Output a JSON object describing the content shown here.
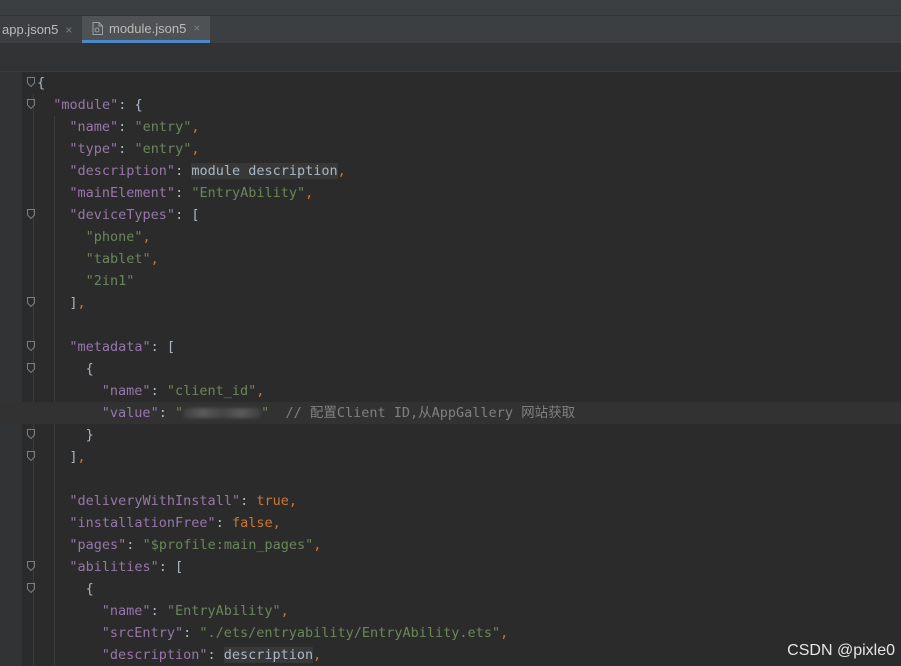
{
  "tabs": [
    {
      "label": "app.json5",
      "close": "×"
    },
    {
      "label": "module.json5",
      "close": "×"
    }
  ],
  "icons": {
    "file_icon": "json-file-icon",
    "fold_icon": "fold-marker-icon"
  },
  "colors": {
    "key": "#9876aa",
    "string": "#6a8759",
    "punct": "#a9b7c6",
    "keyword": "#cc7832",
    "comment": "#808080",
    "tab_underline": "#4a88c7"
  },
  "code_lines": [
    {
      "fold": true,
      "indent": 0,
      "tokens": [
        {
          "t": "p",
          "v": "{"
        }
      ]
    },
    {
      "fold": true,
      "indent": 1,
      "tokens": [
        {
          "t": "k",
          "v": "\"module\""
        },
        {
          "t": "p",
          "v": ": {"
        }
      ]
    },
    {
      "fold": false,
      "indent": 2,
      "tokens": [
        {
          "t": "k",
          "v": "\"name\""
        },
        {
          "t": "p",
          "v": ": "
        },
        {
          "t": "s",
          "v": "\"entry\""
        },
        {
          "t": "c",
          "v": ","
        }
      ]
    },
    {
      "fold": false,
      "indent": 2,
      "tokens": [
        {
          "t": "k",
          "v": "\"type\""
        },
        {
          "t": "p",
          "v": ": "
        },
        {
          "t": "s",
          "v": "\"entry\""
        },
        {
          "t": "c",
          "v": ","
        }
      ]
    },
    {
      "fold": false,
      "indent": 2,
      "tokens": [
        {
          "t": "k",
          "v": "\"description\""
        },
        {
          "t": "p",
          "v": ": "
        },
        {
          "t": "u",
          "v": "module description"
        },
        {
          "t": "c",
          "v": ","
        }
      ]
    },
    {
      "fold": false,
      "indent": 2,
      "tokens": [
        {
          "t": "k",
          "v": "\"mainElement\""
        },
        {
          "t": "p",
          "v": ": "
        },
        {
          "t": "s",
          "v": "\"EntryAbility\""
        },
        {
          "t": "c",
          "v": ","
        }
      ]
    },
    {
      "fold": true,
      "indent": 2,
      "tokens": [
        {
          "t": "k",
          "v": "\"deviceTypes\""
        },
        {
          "t": "p",
          "v": ": ["
        }
      ]
    },
    {
      "fold": false,
      "indent": 3,
      "tokens": [
        {
          "t": "s",
          "v": "\"phone\""
        },
        {
          "t": "c",
          "v": ","
        }
      ]
    },
    {
      "fold": false,
      "indent": 3,
      "tokens": [
        {
          "t": "s",
          "v": "\"tablet\""
        },
        {
          "t": "c",
          "v": ","
        }
      ]
    },
    {
      "fold": false,
      "indent": 3,
      "tokens": [
        {
          "t": "s",
          "v": "\"2in1\""
        }
      ]
    },
    {
      "fold": true,
      "indent": 2,
      "tokens": [
        {
          "t": "p",
          "v": "]"
        },
        {
          "t": "c",
          "v": ","
        }
      ]
    },
    {
      "fold": false,
      "indent": 0,
      "tokens": []
    },
    {
      "fold": true,
      "indent": 2,
      "tokens": [
        {
          "t": "k",
          "v": "\"metadata\""
        },
        {
          "t": "p",
          "v": ": ["
        }
      ]
    },
    {
      "fold": true,
      "indent": 3,
      "tokens": [
        {
          "t": "p",
          "v": "{"
        }
      ]
    },
    {
      "fold": false,
      "indent": 4,
      "tokens": [
        {
          "t": "k",
          "v": "\"name\""
        },
        {
          "t": "p",
          "v": ": "
        },
        {
          "t": "s",
          "v": "\"client_id\""
        },
        {
          "t": "c",
          "v": ","
        }
      ]
    },
    {
      "fold": false,
      "indent": 4,
      "current": true,
      "tokens": [
        {
          "t": "k",
          "v": "\"value\""
        },
        {
          "t": "p",
          "v": ": "
        },
        {
          "t": "s",
          "v": "\""
        },
        {
          "t": "blur",
          "v": ""
        },
        {
          "t": "s",
          "v": "\""
        },
        {
          "t": "cm",
          "v": "  // 配置Client ID,从AppGallery 网站获取"
        }
      ]
    },
    {
      "fold": true,
      "indent": 3,
      "tokens": [
        {
          "t": "p",
          "v": "}"
        }
      ]
    },
    {
      "fold": true,
      "indent": 2,
      "tokens": [
        {
          "t": "p",
          "v": "]"
        },
        {
          "t": "c",
          "v": ","
        }
      ]
    },
    {
      "fold": false,
      "indent": 0,
      "tokens": []
    },
    {
      "fold": false,
      "indent": 2,
      "tokens": [
        {
          "t": "k",
          "v": "\"deliveryWithInstall\""
        },
        {
          "t": "p",
          "v": ": "
        },
        {
          "t": "b",
          "v": "true"
        },
        {
          "t": "c",
          "v": ","
        }
      ]
    },
    {
      "fold": false,
      "indent": 2,
      "tokens": [
        {
          "t": "k",
          "v": "\"installationFree\""
        },
        {
          "t": "p",
          "v": ": "
        },
        {
          "t": "b",
          "v": "false"
        },
        {
          "t": "c",
          "v": ","
        }
      ]
    },
    {
      "fold": false,
      "indent": 2,
      "tokens": [
        {
          "t": "k",
          "v": "\"pages\""
        },
        {
          "t": "p",
          "v": ": "
        },
        {
          "t": "s",
          "v": "\"$profile:main_pages\""
        },
        {
          "t": "c",
          "v": ","
        }
      ]
    },
    {
      "fold": true,
      "indent": 2,
      "tokens": [
        {
          "t": "k",
          "v": "\"abilities\""
        },
        {
          "t": "p",
          "v": ": ["
        }
      ]
    },
    {
      "fold": true,
      "indent": 3,
      "tokens": [
        {
          "t": "p",
          "v": "{"
        }
      ]
    },
    {
      "fold": false,
      "indent": 4,
      "tokens": [
        {
          "t": "k",
          "v": "\"name\""
        },
        {
          "t": "p",
          "v": ": "
        },
        {
          "t": "s",
          "v": "\"EntryAbility\""
        },
        {
          "t": "c",
          "v": ","
        }
      ]
    },
    {
      "fold": false,
      "indent": 4,
      "tokens": [
        {
          "t": "k",
          "v": "\"srcEntry\""
        },
        {
          "t": "p",
          "v": ": "
        },
        {
          "t": "s",
          "v": "\"./ets/entryability/EntryAbility.ets\""
        },
        {
          "t": "c",
          "v": ","
        }
      ]
    },
    {
      "fold": false,
      "indent": 4,
      "tokens": [
        {
          "t": "k",
          "v": "\"description\""
        },
        {
          "t": "p",
          "v": ": "
        },
        {
          "t": "u",
          "v": "description"
        },
        {
          "t": "c",
          "v": ","
        }
      ]
    }
  ],
  "watermark": "CSDN @pixle0"
}
